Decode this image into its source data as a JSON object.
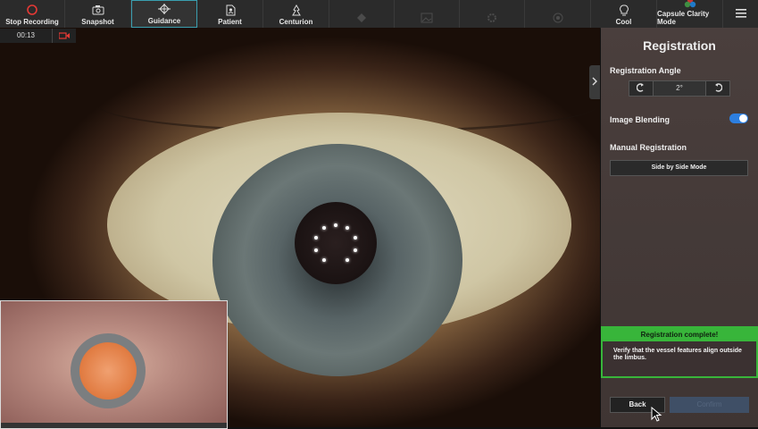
{
  "toolbar": {
    "items": [
      {
        "label": "Stop Recording",
        "icon": "stop-record-icon",
        "state": "normal"
      },
      {
        "label": "Snapshot",
        "icon": "camera-icon",
        "state": "normal"
      },
      {
        "label": "Guidance",
        "icon": "guidance-icon",
        "state": "active"
      },
      {
        "label": "Patient",
        "icon": "patient-file-icon",
        "state": "normal"
      },
      {
        "label": "Centurion",
        "icon": "centurion-icon",
        "state": "normal"
      },
      {
        "label": "",
        "icon": "diamond-icon",
        "state": "disabled"
      },
      {
        "label": "",
        "icon": "image-icon",
        "state": "disabled"
      },
      {
        "label": "",
        "icon": "settings-icon",
        "state": "disabled"
      },
      {
        "label": "",
        "icon": "circle-icon",
        "state": "disabled"
      },
      {
        "label": "Cool",
        "icon": "bulb-icon",
        "state": "normal"
      },
      {
        "label": "Capsule Clarity Mode",
        "icon": "capsule-clarity-icon",
        "state": "normal"
      }
    ],
    "menu_icon": "hamburger-menu-icon"
  },
  "recording": {
    "time": "00:13",
    "icon": "video-camera-icon"
  },
  "panel": {
    "title": "Registration",
    "angle_label": "Registration Angle",
    "angle_value": "2°",
    "blending_label": "Image Blending",
    "blending_on": true,
    "manual_label": "Manual Registration",
    "side_by_side": "Side by Side Mode",
    "banner_title": "Registration complete!",
    "banner_message": "Verify that the vessel features align outside the limbus.",
    "back": "Back",
    "confirm": "Confirm"
  },
  "colors": {
    "accent_green": "#38b53a",
    "toggle_blue": "#2d7fe0",
    "record_red": "#e53935",
    "active_border": "#3a9fb0"
  }
}
